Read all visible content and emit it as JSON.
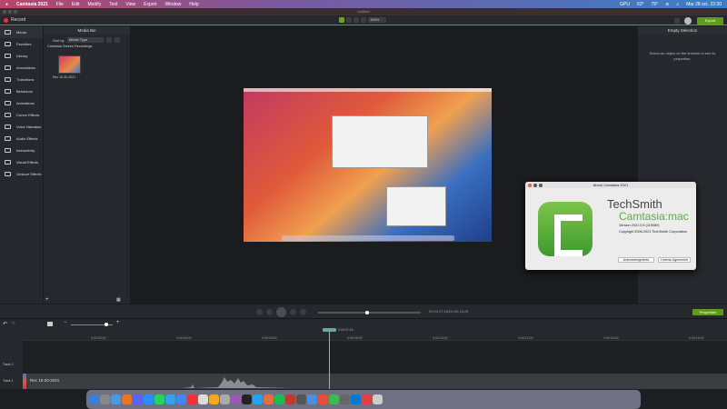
{
  "menubar": {
    "app": "Camtasia 2021",
    "items": [
      "File",
      "Edit",
      "Modify",
      "Text",
      "View",
      "Export",
      "Window",
      "Help"
    ],
    "status": {
      "gpu": "GPU",
      "temp1": "63°",
      "temp2": "79°",
      "datetime": "Mar 28 oct. 22:30"
    }
  },
  "window": {
    "title": "Untitled"
  },
  "toolbar": {
    "record": "Record",
    "zoom": "100%",
    "export": "Export"
  },
  "rail": [
    {
      "label": "Media",
      "icon": "media-icon"
    },
    {
      "label": "Favorites",
      "icon": "star-icon"
    },
    {
      "label": "Library",
      "icon": "library-icon"
    },
    {
      "label": "Annotations",
      "icon": "annotations-icon"
    },
    {
      "label": "Transitions",
      "icon": "transitions-icon"
    },
    {
      "label": "Behaviors",
      "icon": "behaviors-icon"
    },
    {
      "label": "Animations",
      "icon": "animations-icon"
    },
    {
      "label": "Cursor Effects",
      "icon": "cursor-icon"
    },
    {
      "label": "Voice Narration",
      "icon": "mic-icon"
    },
    {
      "label": "Audio Effects",
      "icon": "speaker-icon"
    },
    {
      "label": "Interactivity",
      "icon": "interactivity-icon"
    },
    {
      "label": "Visual Effects",
      "icon": "wand-icon"
    },
    {
      "label": "Gesture Effects",
      "icon": "hand-icon"
    }
  ],
  "media_bin": {
    "title": "Media Bin",
    "sort_label": "Sort by",
    "sort_value": "Media Type",
    "group": "Camtasia Screen Recordings",
    "clip": "Rec 10-20-2021"
  },
  "properties": {
    "title": "Empty Selection",
    "hint": "Select an object on the timeline to see its properties.",
    "button": "Properties"
  },
  "about": {
    "title": "About Camtasia 2021",
    "brand": "TechSmith",
    "product": "Camtasia:mac",
    "version": "Version 2021.0.5 (115080)",
    "copyright": "Copyright 2006-2021 TechSmith Corporation",
    "ack": "Acknowledgments",
    "license": "License Agreement"
  },
  "playback": {
    "time": "00:00:07;16/00:00:15;26",
    "progress": 0.48
  },
  "timeline": {
    "playhead": "0:00:07;16",
    "ticks": [
      "0:00:02;00",
      "0:00:04;00",
      "0:00:06;00",
      "0:00:08;00",
      "0:00:10;00",
      "0:00:12;00",
      "0:00:14;00",
      "0:00:16;00"
    ],
    "tracks": [
      "Track 2",
      "Track 1"
    ],
    "clip": "Rec 10-20-2021"
  },
  "colors": {
    "accent": "#5e9c19",
    "record": "#e33333"
  }
}
